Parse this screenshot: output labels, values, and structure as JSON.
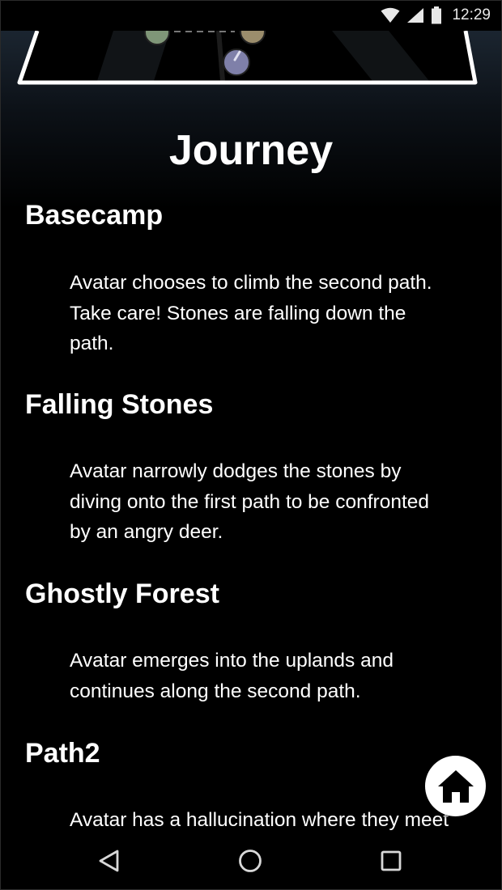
{
  "status_bar": {
    "time": "12:29",
    "icons": [
      "wifi-icon",
      "signal-icon",
      "battery-icon"
    ]
  },
  "page": {
    "title": "Journey"
  },
  "entries": [
    {
      "heading": "Basecamp",
      "body": "Avatar chooses to climb the second path.\nTake care! Stones are falling down the\npath."
    },
    {
      "heading": "Falling Stones",
      "body": "Avatar narrowly dodges the stones by\ndiving onto the first path to be confronted\nby an angry deer."
    },
    {
      "heading": "Ghostly Forest",
      "body": "Avatar emerges into the uplands and\ncontinues along the second path."
    },
    {
      "heading": "Path2",
      "body": "Avatar has a hallucination where they meet"
    }
  ],
  "fab": {
    "icon": "home-icon"
  },
  "nav_bar": {
    "back_icon": "back-triangle-icon",
    "home_icon": "home-circle-icon",
    "recents_icon": "recents-square-icon"
  },
  "colors": {
    "background": "#000000",
    "text": "#ffffff",
    "header_glow": "#1b2530"
  }
}
